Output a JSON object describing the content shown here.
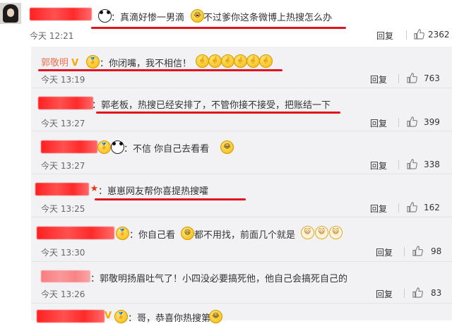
{
  "main_comment": {
    "text": "：真滴好惨一男滴",
    "text2": "不过爹你这条微博上热搜怎么办",
    "time": "今天 12:21",
    "reply_label": "回复",
    "likes": "2362"
  },
  "replies": [
    {
      "name": "郭敬明",
      "badge": "V",
      "text": "：你闭嘴，我不相信！",
      "time": "今天 13:19",
      "reply_label": "回复",
      "likes": "763"
    },
    {
      "text": "：郭老板，热搜已经安排了，不管你接不接受，把账结一下",
      "time": "今天 13:27",
      "reply_label": "回复",
      "likes": "399"
    },
    {
      "text": "：不信   你自己去看看",
      "time": "今天 13:27",
      "reply_label": "回复",
      "likes": "338"
    },
    {
      "text": "：崽崽网友帮你喜提热搜嚯",
      "time": "今天 13:25",
      "reply_label": "回复",
      "likes": "162"
    },
    {
      "text": "：你自己看",
      "text2": "都不用找，前面几个就是",
      "time": "今天 13:30",
      "reply_label": "回复",
      "likes": "98"
    },
    {
      "text": "：郭敬明扬眉吐气了！小四没必要搞死他，他自己会搞死自己的",
      "time": "今天 13:26",
      "reply_label": "回复",
      "likes": "83"
    },
    {
      "text": "：哥，恭喜你热搜第一"
    }
  ],
  "colors": {
    "underline": "#e0141f",
    "name_link": "#eb7350",
    "sub_bg": "#f2f2f5"
  },
  "icons": [
    "panda-emoji",
    "crying-emoji",
    "like-thumb-icon",
    "fingers-crossed-emoji",
    "laugh-emoji",
    "cat-emoji",
    "star-icon"
  ]
}
